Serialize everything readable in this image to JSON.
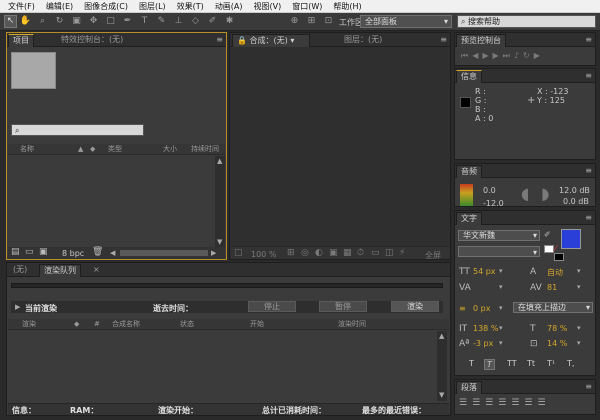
{
  "menu": [
    "文件(F)",
    "编辑(E)",
    "图像合成(C)",
    "图层(L)",
    "效果(T)",
    "动画(A)",
    "视图(V)",
    "窗口(W)",
    "帮助(H)"
  ],
  "toolbar": {
    "workspace_label": "工作区：",
    "workspace_value": "全部面板",
    "search_placeholder": "搜索帮助"
  },
  "project": {
    "tab": "项目",
    "effects_tab": "特效控制台：(无)",
    "columns": {
      "name": "名称",
      "type": "类型",
      "size": "大小",
      "duration": "持续时间"
    },
    "bpc": "8 bpc"
  },
  "comp": {
    "tab": "合成：(无)",
    "layer_tab": "图层：(无)",
    "zoom": "100 %",
    "full": "全屏"
  },
  "preview": {
    "tab": "预览控制台"
  },
  "info": {
    "tab": "信息",
    "r": "R :",
    "g": "G :",
    "b": "B :",
    "a": "A : 0",
    "x": "X : -123",
    "y": "Y : 125"
  },
  "audio": {
    "tab": "音频",
    "l1": "0.0",
    "l2": "-12.0",
    "r1": "12.0 dB",
    "r2": "0.0 dB"
  },
  "text": {
    "tab": "文字",
    "font": "华文新魏",
    "size": "54 px",
    "leading": "自动",
    "kerning": "",
    "tracking": "81",
    "stroke": "0 px",
    "stroke_mode": "在填充上描边",
    "vscale": "138 %",
    "hscale": "78 %",
    "baseline": "-3 px",
    "tsume": "14 %",
    "styles": [
      "T",
      "T",
      "TT",
      "Tt",
      "T¹",
      "T,"
    ]
  },
  "para": {
    "tab": "段落"
  },
  "render": {
    "tab_none": "(无)",
    "tab": "渲染队列",
    "current": "当前渲染",
    "elapsed": "逝去时间：",
    "stop": "停止",
    "pause": "暂停",
    "render": "渲染",
    "cols": {
      "render": "渲染",
      "num": "#",
      "comp": "合成名称",
      "status": "状态",
      "start": "开始",
      "time": "渲染时间"
    },
    "footer": {
      "info": "信息：",
      "ram": "RAM：",
      "start": "渲染开始：",
      "total": "总计已消耗时间：",
      "recent": "最多的最近错误："
    }
  },
  "colors": {
    "fill": "#2a3fd8",
    "accent": "#d4a82a"
  }
}
